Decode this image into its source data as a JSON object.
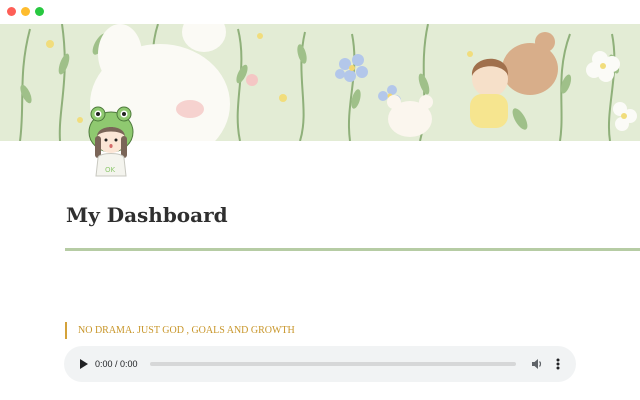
{
  "window": {
    "controls": [
      "close",
      "minimize",
      "zoom"
    ]
  },
  "cover": {
    "description_icon": "floral-illustration"
  },
  "page": {
    "title": "My Dashboard",
    "accent_color": "#b6cca4"
  },
  "quote": {
    "text": "NO DRAMA. JUST GOD , GOALS AND GROWTH",
    "color": "#c8962a"
  },
  "audio": {
    "time_display": "0:00 / 0:00",
    "progress": 0,
    "play_icon": "play-icon",
    "volume_icon": "volume-icon",
    "menu_icon": "more-vert-icon"
  },
  "avatar": {
    "badge_text": "OK"
  }
}
